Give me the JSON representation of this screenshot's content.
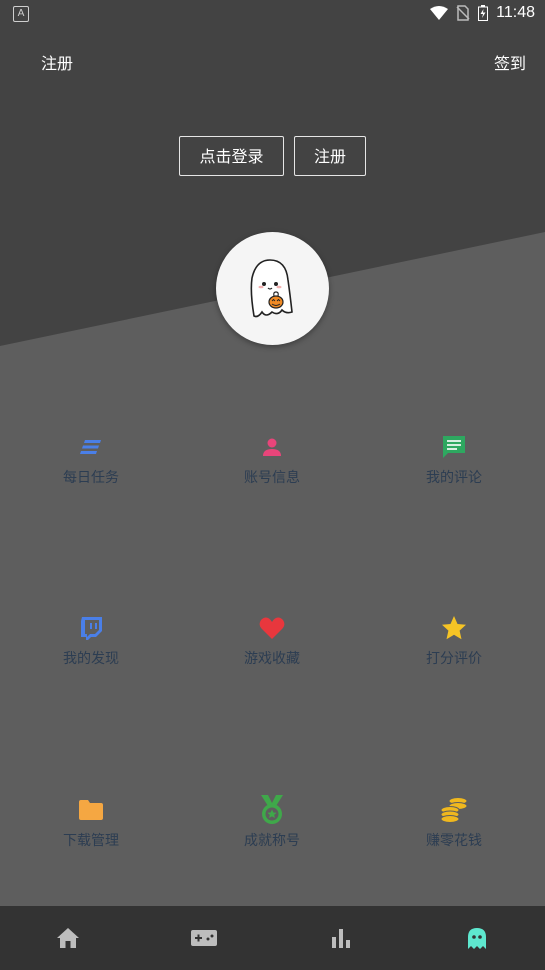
{
  "status_bar": {
    "app_badge": "A",
    "time": "11:48"
  },
  "header": {
    "left_link": "注册",
    "right_link": "签到"
  },
  "auth": {
    "login_label": "点击登录",
    "register_label": "注册"
  },
  "menu": {
    "items": [
      {
        "label": "每日任务",
        "icon": "list-icon",
        "color": "#4a7fe8"
      },
      {
        "label": "账号信息",
        "icon": "person-icon",
        "color": "#e8457a"
      },
      {
        "label": "我的评论",
        "icon": "comment-icon",
        "color": "#2ea860"
      },
      {
        "label": "我的发现",
        "icon": "twitch-icon",
        "color": "#4a7fe8"
      },
      {
        "label": "游戏收藏",
        "icon": "heart-icon",
        "color": "#e8373d"
      },
      {
        "label": "打分评价",
        "icon": "star-icon",
        "color": "#f6c425"
      },
      {
        "label": "下载管理",
        "icon": "folder-icon",
        "color": "#f5a742"
      },
      {
        "label": "成就称号",
        "icon": "medal-icon",
        "color": "#3fa84a"
      },
      {
        "label": "赚零花钱",
        "icon": "coins-icon",
        "color": "#f0b81e"
      }
    ]
  },
  "bottom_nav": {
    "tabs": [
      "home-icon",
      "gamepad-icon",
      "chart-icon",
      "ghost-icon"
    ],
    "active_color": "#5ee8cf",
    "inactive_color": "#bdbdbd"
  }
}
